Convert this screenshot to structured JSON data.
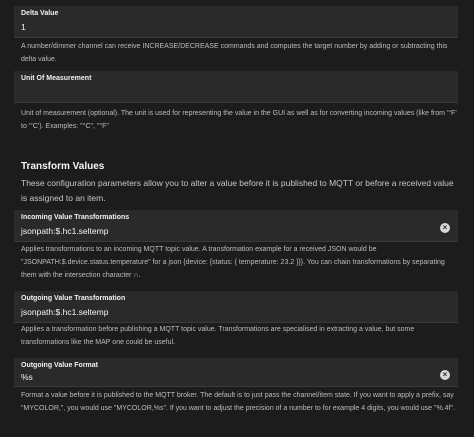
{
  "delta": {
    "label": "Delta Value",
    "value": "1",
    "description": "A number/dimmer channel can receive INCREASE/DECREASE commands and computes the target number by adding or subtracting this delta value."
  },
  "unit": {
    "label": "Unit Of Measurement",
    "value": "",
    "description": "Unit of measurement (optional). The unit is used for representing the value in the GUI as well as for converting incoming values (like from '°F' to '°C'). Examples: \"°C\", \"°F\""
  },
  "transform_section": {
    "title": "Transform Values",
    "description": "These configuration parameters allow you to alter a value before it is published to MQTT or before a received value is assigned to an item."
  },
  "incoming": {
    "label": "Incoming Value Transformations",
    "value": "jsonpath:$.hc1.seltemp",
    "clear_icon": "close-circle-icon",
    "description": "Applies transformations to an incoming MQTT topic value. A transformation example for a received JSON would be \"JSONPATH:$.device.status.temperature\" for a json {device: {status: { temperature: 23.2 }}}. You can chain transformations by separating them with the intersection character ∩."
  },
  "outgoing": {
    "label": "Outgoing Value Transformation",
    "value": "jsonpath:$.hc1.seltemp",
    "description": "Applies a transformation before publishing a MQTT topic value. Transformations are specialised in extracting a value, but some transformations like the MAP one could be useful."
  },
  "format": {
    "label": "Outgoing Value Format",
    "value": "%s",
    "clear_icon": "close-circle-icon",
    "description": "Format a value before it is published to the MQTT broker. The default is to just pass the channel/item state. If you want to apply a prefix, say \"MYCOLOR,\", you would use \"MYCOLOR,%s\". If you want to adjust the precision of a number to for example 4 digits, you would use \"%.4f\"."
  }
}
